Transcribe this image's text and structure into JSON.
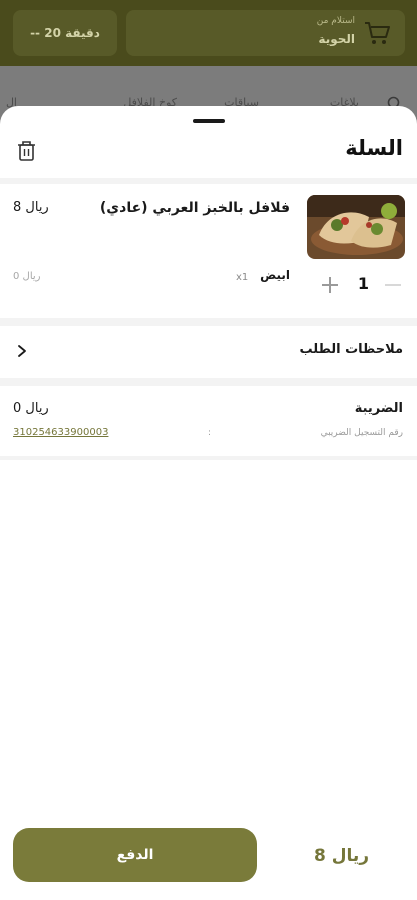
{
  "background": {
    "pickup_label": "استلام من",
    "pickup_location": "الحوية",
    "delivery_time": "-- 20 دقيقة",
    "tabs": [
      "بلاغات",
      "سباقات",
      "كوخ الفلافل",
      "ال"
    ]
  },
  "cart": {
    "title": "السلة",
    "item": {
      "name": "فلافل بالخبز العربي (عادي)",
      "price": "8 ريال",
      "quantity": "1",
      "option_name": "ابيض",
      "option_qty": "x1",
      "option_price": "0 ريال"
    },
    "notes_label": "ملاحظات الطلب",
    "tax_label": "الضريبة",
    "tax_value": "0 ريال",
    "vat_label": "رقم التسجيل الضريبي",
    "vat_colon": ":",
    "vat_number": "310254633900003",
    "pay_label": "الدفع",
    "total": "8 ريال"
  },
  "colors": {
    "brand": "#7a7b3a",
    "brand_text": "#75763a",
    "overlay_header": "#4a4b1c",
    "overlay_body": "#7c7c7c"
  },
  "icons": [
    "cart-icon",
    "search-icon",
    "trash-icon",
    "plus-icon",
    "minus-icon",
    "chevron-right-icon"
  ]
}
